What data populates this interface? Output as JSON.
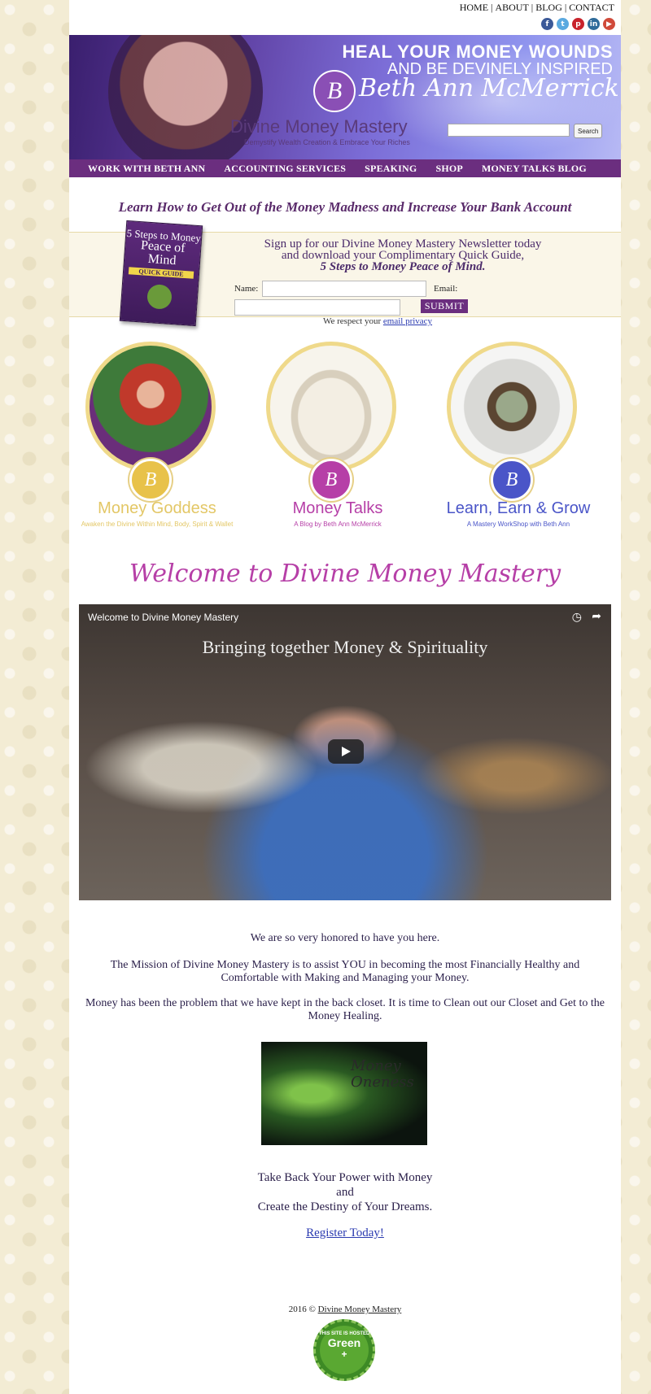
{
  "top_links": {
    "home": "HOME",
    "about": "ABOUT",
    "blog": "BLOG",
    "contact": "CONTACT",
    "sep": "|"
  },
  "social": [
    {
      "name": "facebook",
      "glyph": "f",
      "color": "#3b5998"
    },
    {
      "name": "twitter",
      "glyph": "t",
      "color": "#5aa9e0"
    },
    {
      "name": "pinterest",
      "glyph": "p",
      "color": "#c8232c"
    },
    {
      "name": "linkedin",
      "glyph": "in",
      "color": "#2f6b9a"
    },
    {
      "name": "youtube",
      "glyph": "▶",
      "color": "#d04a3a"
    }
  ],
  "banner": {
    "heal_line1": "HEAL YOUR MONEY WOUNDS",
    "heal_line2": "AND BE DEVINELY INSPIRED",
    "logo_letter": "B",
    "name": "Beth Ann McMerrick",
    "brand": "Divine Money Mastery",
    "tagline": "Demystify Wealth Creation & Embrace Your Riches",
    "search_button": "Search"
  },
  "nav": [
    "WORK WITH BETH ANN",
    "ACCOUNTING SERVICES",
    "SPEAKING",
    "SHOP",
    "MONEY TALKS BLOG"
  ],
  "headline": "Learn How to Get Out of the Money Madness and Increase Your Bank Account",
  "newsletter": {
    "book_title1": "5 Steps to Money",
    "book_title2": "Peace of Mind",
    "book_badge": "QUICK GUIDE",
    "line1": "Sign up for our Divine Money Mastery Newsletter today",
    "line2": "and download your Complimentary Quick Guide,",
    "line3": "5 Steps to Money Peace of Mind.",
    "name_label": "Name:",
    "email_label": "Email:",
    "submit": "SUBMIT",
    "privacy_text": "We respect your",
    "privacy_link": "email privacy"
  },
  "features": [
    {
      "title": "Money Goddess",
      "subtitle": "Awaken the Divine Within Mind, Body, Spirit & Wallet",
      "title_color": "#e3c766",
      "badge_color": "#e8c24a",
      "image": "goddess"
    },
    {
      "title": "Money Talks",
      "subtitle": "A Blog by Beth Ann McMerrick",
      "title_color": "#b63fa7",
      "badge_color": "#b63fa7",
      "image": "purse"
    },
    {
      "title": "Learn, Earn & Grow",
      "subtitle": "A Mastery WorkShop with Beth Ann",
      "title_color": "#4a55c8",
      "badge_color": "#4a55c8",
      "image": "money-tree"
    }
  ],
  "welcome": "Welcome to Divine Money Mastery",
  "video": {
    "title": "Welcome to Divine Money Mastery",
    "overlay": "Bringing together Money & Spirituality"
  },
  "body": {
    "p1": "We are so very honored to have you here.",
    "p2": "The Mission of Divine Money Mastery is to assist YOU in becoming the most Financially Healthy and Comfortable with Making and Managing your Money.",
    "p3": "Money has been the problem that we have kept in the back closet. It is time to Clean out our Closet and Get to the Money Healing.",
    "image_text": "Money Oneness",
    "cta1": "Take Back Your Power with Money",
    "cta2": "and",
    "cta3": "Create the Destiny of Your Dreams.",
    "register": "Register Today!"
  },
  "footer": {
    "copyright": "2016 ©",
    "link": "Divine Money Mastery",
    "green1": "THIS SITE IS HOSTED",
    "green2": "Green",
    "green3": "+"
  }
}
